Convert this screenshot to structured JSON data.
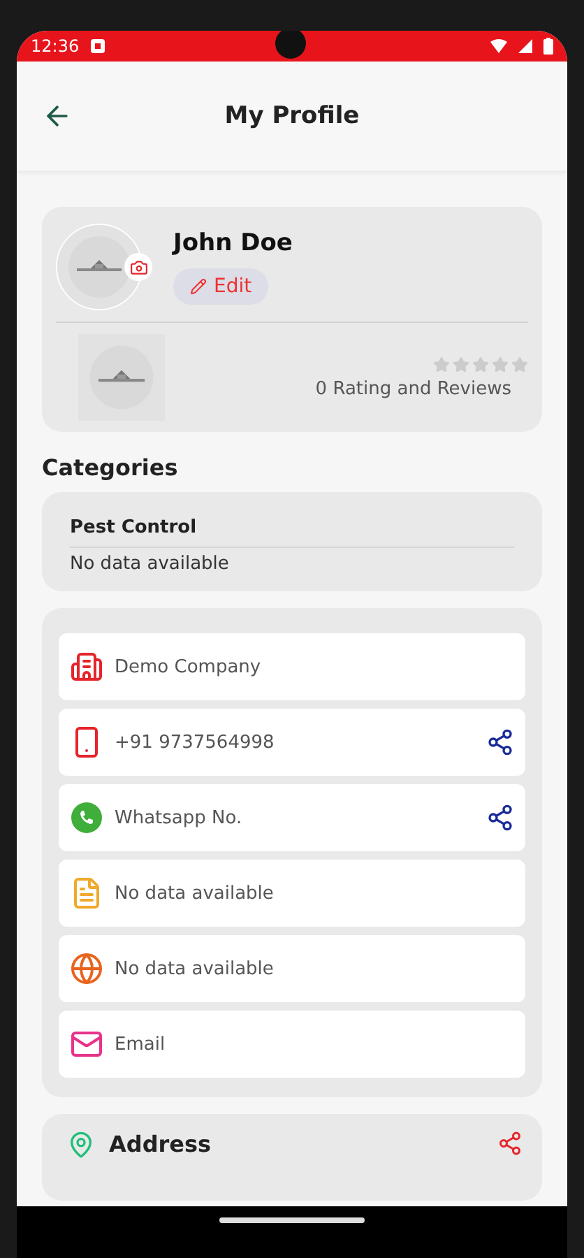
{
  "status_bar": {
    "time": "12:36"
  },
  "header": {
    "title": "My Profile"
  },
  "profile": {
    "name": "John Doe",
    "edit_label": "Edit",
    "stars": 0,
    "rating_text": "0 Rating and Reviews"
  },
  "categories": {
    "heading": "Categories",
    "items": [
      {
        "name": "Pest Control",
        "detail": "No data available"
      }
    ]
  },
  "contacts": [
    {
      "kind": "company",
      "text": "Demo Company",
      "shareable": false
    },
    {
      "kind": "phone",
      "text": "+91 9737564998",
      "shareable": true
    },
    {
      "kind": "whatsapp",
      "text": "Whatsapp No.",
      "shareable": true
    },
    {
      "kind": "tax",
      "text": "No data available",
      "shareable": false
    },
    {
      "kind": "web",
      "text": "No data available",
      "shareable": false
    },
    {
      "kind": "email",
      "text": "Email",
      "shareable": false
    }
  ],
  "address": {
    "heading": "Address"
  }
}
